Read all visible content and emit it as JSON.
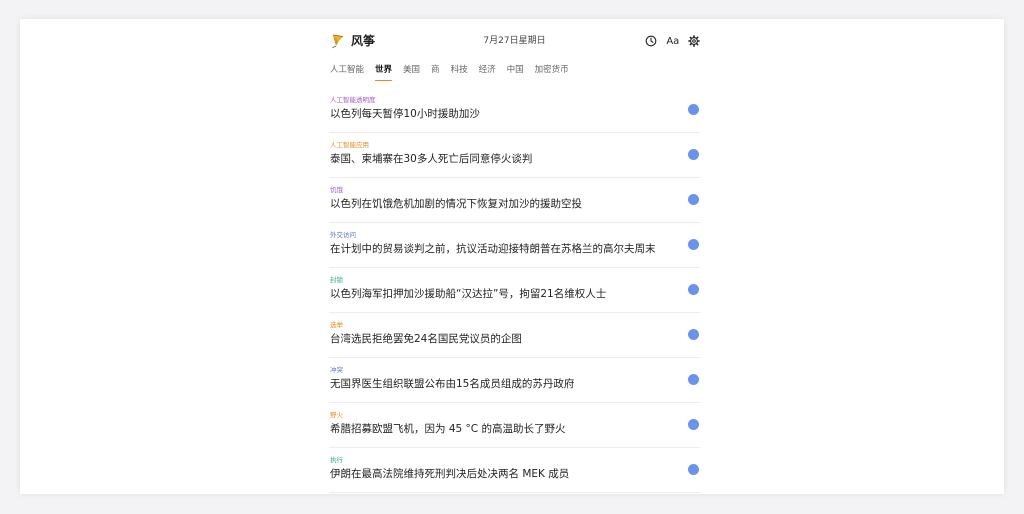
{
  "header": {
    "app_name": "风筝",
    "date": "7月27日星期日",
    "font_size_label": "Aa",
    "icons": {
      "logo": "kite-logo-icon",
      "history": "clock-icon",
      "font_size": "text-size-icon",
      "settings": "gear-icon"
    }
  },
  "tabs": [
    {
      "label": "人工智能",
      "active": false
    },
    {
      "label": "世界",
      "active": true
    },
    {
      "label": "美国",
      "active": false
    },
    {
      "label": "商",
      "active": false
    },
    {
      "label": "科技",
      "active": false
    },
    {
      "label": "经济",
      "active": false
    },
    {
      "label": "中国",
      "active": false
    },
    {
      "label": "加密货币",
      "active": false
    }
  ],
  "colors": {
    "active_tab_underline": "#e88a1a",
    "read_indicator": "#6b93ee"
  },
  "stories": [
    {
      "category": "人工智能透明度",
      "category_color": "#a35bd1",
      "title": "以色列每天暂停10小时援助加沙"
    },
    {
      "category": "人工智能应用",
      "category_color": "#e88a1a",
      "title": "泰国、柬埔寨在30多人死亡后同意停火谈判"
    },
    {
      "category": "饥饿",
      "category_color": "#a35bd1",
      "title": "以色列在饥饿危机加剧的情况下恢复对加沙的援助空投"
    },
    {
      "category": "外交访问",
      "category_color": "#5a6fd1",
      "title": "在计划中的贸易谈判之前，抗议活动迎接特朗普在苏格兰的高尔夫周末"
    },
    {
      "category": "封锁",
      "category_color": "#2bab8f",
      "title": "以色列海军扣押加沙援助船“汉达拉”号，拘留21名维权人士"
    },
    {
      "category": "选举",
      "category_color": "#e88a1a",
      "title": "台湾选民拒绝罢免24名国民党议员的企图"
    },
    {
      "category": "冲突",
      "category_color": "#5a6fd1",
      "title": "无国界医生组织联盟公布由15名成员组成的苏丹政府"
    },
    {
      "category": "野火",
      "category_color": "#e88a1a",
      "title": "希腊招募欧盟飞机，因为 45 °C 的高温助长了野火"
    },
    {
      "category": "执行",
      "category_color": "#2bab8f",
      "title": "伊朗在最高法院维持死刑判决后处决两名 MEK 成员"
    }
  ]
}
